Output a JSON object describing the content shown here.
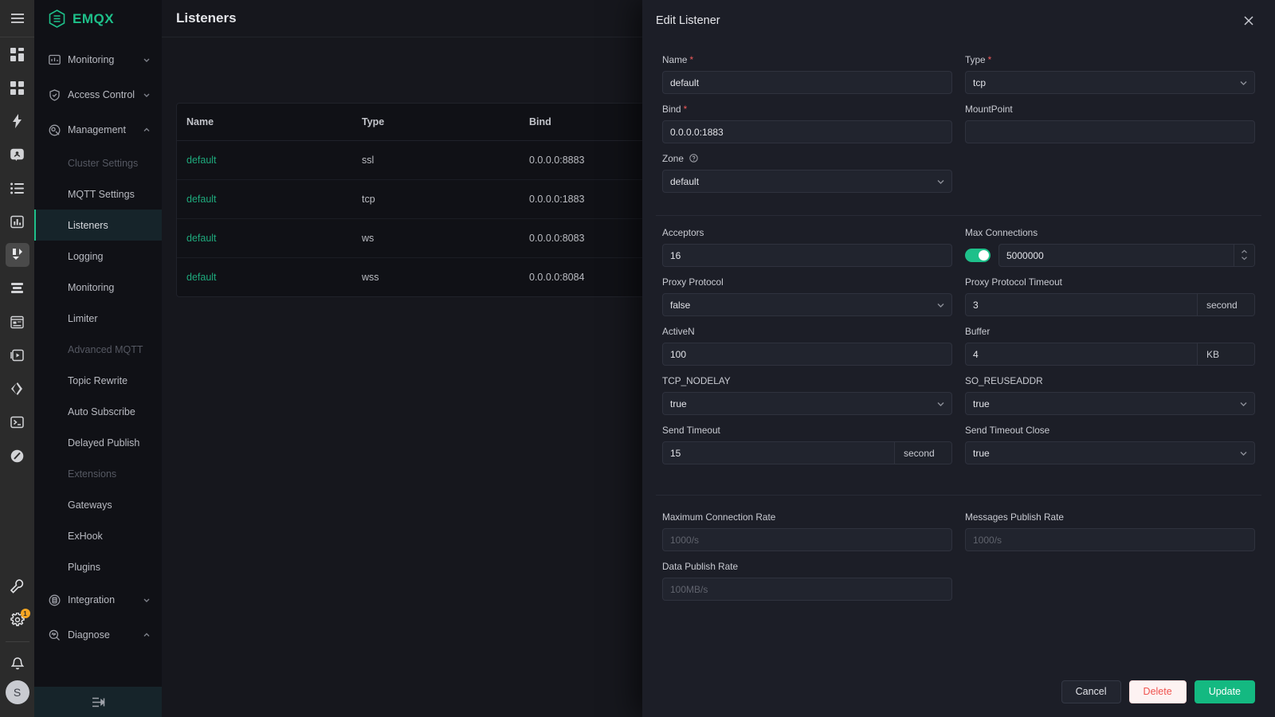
{
  "brand": {
    "name": "EMQX",
    "logo_icon": "emqx-hexagon-logo"
  },
  "icon_rail": {
    "menu_icon": "hamburger-menu-icon",
    "items": [
      {
        "icon": "dashboard-grid-icon",
        "active": false
      },
      {
        "icon": "dashboard-grid-alt-icon",
        "active": false
      },
      {
        "icon": "lightning-bolt-icon",
        "active": false
      },
      {
        "icon": "client-card-icon",
        "active": false
      },
      {
        "icon": "list-bullets-icon",
        "active": false
      },
      {
        "icon": "bar-chart-icon",
        "active": false
      },
      {
        "icon": "listeners-zigzag-icon",
        "active": true
      },
      {
        "icon": "layers-stack-icon",
        "active": false
      },
      {
        "icon": "mqtt-module-icon",
        "active": false
      },
      {
        "icon": "play-box-icon",
        "active": false
      },
      {
        "icon": "code-brackets-icon",
        "active": false
      },
      {
        "icon": "terminal-icon",
        "active": false
      },
      {
        "icon": "slash-circle-icon",
        "active": false
      }
    ],
    "bottom_items": [
      {
        "icon": "wrench-icon",
        "badge": ""
      },
      {
        "icon": "gear-icon",
        "badge": "1"
      },
      {
        "icon": "bell-icon",
        "badge": ""
      }
    ],
    "avatar_initial": "S"
  },
  "sidebar": {
    "groups": [
      {
        "label": "Monitoring",
        "icon": "monitor-chart-icon",
        "expanded": false,
        "chevron": "chevron-down-icon"
      },
      {
        "label": "Access Control",
        "icon": "shield-check-icon",
        "expanded": false,
        "chevron": "chevron-down-icon"
      },
      {
        "label": "Management",
        "icon": "management-cog-icon",
        "expanded": true,
        "chevron": "chevron-up-icon"
      }
    ],
    "management_items": [
      {
        "label": "Cluster Settings",
        "state": "dim"
      },
      {
        "label": "MQTT Settings",
        "state": "normal"
      },
      {
        "label": "Listeners",
        "state": "active"
      },
      {
        "label": "Logging",
        "state": "normal"
      },
      {
        "label": "Monitoring",
        "state": "normal"
      },
      {
        "label": "Limiter",
        "state": "normal"
      },
      {
        "label": "Advanced MQTT",
        "state": "dim"
      },
      {
        "label": "Topic Rewrite",
        "state": "normal"
      },
      {
        "label": "Auto Subscribe",
        "state": "normal"
      },
      {
        "label": "Delayed Publish",
        "state": "normal"
      },
      {
        "label": "Extensions",
        "state": "dim"
      },
      {
        "label": "Gateways",
        "state": "normal"
      },
      {
        "label": "ExHook",
        "state": "normal"
      },
      {
        "label": "Plugins",
        "state": "normal"
      }
    ],
    "trailing_groups": [
      {
        "label": "Integration",
        "icon": "integration-icon",
        "chevron": "chevron-down-icon"
      },
      {
        "label": "Diagnose",
        "icon": "diagnose-search-icon",
        "chevron": "chevron-up-icon"
      }
    ],
    "collapse_icon": "collapse-sidebar-icon"
  },
  "page": {
    "title": "Listeners",
    "table": {
      "columns": [
        "Name",
        "Type",
        "Bind"
      ],
      "rows": [
        {
          "name": "default",
          "type": "ssl",
          "bind": "0.0.0.0:8883"
        },
        {
          "name": "default",
          "type": "tcp",
          "bind": "0.0.0.0:1883"
        },
        {
          "name": "default",
          "type": "ws",
          "bind": "0.0.0.0:8083"
        },
        {
          "name": "default",
          "type": "wss",
          "bind": "0.0.0.0:8084"
        }
      ]
    }
  },
  "drawer": {
    "title": "Edit Listener",
    "close_icon": "close-icon",
    "fields": {
      "name": {
        "label": "Name",
        "required": true,
        "value": "default",
        "placeholder": ""
      },
      "type": {
        "label": "Type",
        "required": true,
        "value": "tcp"
      },
      "bind": {
        "label": "Bind",
        "required": true,
        "value": "0.0.0.0:1883",
        "placeholder": ""
      },
      "mountpoint": {
        "label": "MountPoint",
        "required": false,
        "value": "",
        "placeholder": ""
      },
      "zone": {
        "label": "Zone",
        "required": false,
        "value": "default",
        "help_icon": "question-circle-icon"
      },
      "acceptors": {
        "label": "Acceptors",
        "value": "16"
      },
      "max_connections": {
        "label": "Max Connections",
        "value": "5000000",
        "toggle_on": true
      },
      "proxy_protocol": {
        "label": "Proxy Protocol",
        "value": "false"
      },
      "proxy_protocol_timeout": {
        "label": "Proxy Protocol Timeout",
        "value": "3",
        "unit": "second"
      },
      "active_n": {
        "label": "ActiveN",
        "value": "100"
      },
      "buffer": {
        "label": "Buffer",
        "value": "4",
        "unit": "KB"
      },
      "tcp_nodelay": {
        "label": "TCP_NODELAY",
        "value": "true"
      },
      "so_reuseaddr": {
        "label": "SO_REUSEADDR",
        "value": "true"
      },
      "send_timeout": {
        "label": "Send Timeout",
        "value": "15",
        "unit": "second"
      },
      "send_timeout_close": {
        "label": "Send Timeout Close",
        "value": "true"
      },
      "max_conn_rate": {
        "label": "Maximum Connection Rate",
        "value": "",
        "placeholder": "1000/s"
      },
      "messages_publish_rate": {
        "label": "Messages Publish Rate",
        "value": "",
        "placeholder": "1000/s"
      },
      "data_publish_rate": {
        "label": "Data Publish Rate",
        "value": "",
        "placeholder": "100MB/s"
      }
    },
    "footer": {
      "cancel_label": "Cancel",
      "delete_label": "Delete",
      "update_label": "Update"
    }
  },
  "colors": {
    "brand_green": "#1ec08a",
    "accent_green": "#14b981",
    "danger_red": "#f0534f",
    "required_red": "#f05a5a",
    "badge_orange": "#f5a623",
    "drawer_bg": "#1c1e27",
    "page_bg": "#16171d",
    "sidebar_bg": "#101116",
    "rail_bg": "#2b2b2b"
  }
}
